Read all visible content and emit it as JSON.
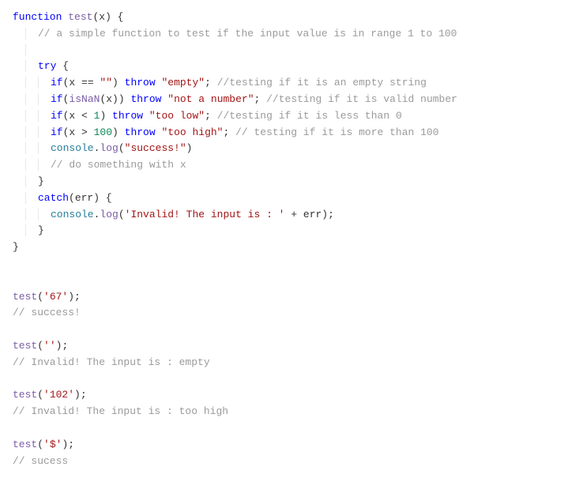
{
  "l1": {
    "kw1": "function",
    "fn": "test",
    "p1": "(",
    "arg": "x",
    "p2": ") {"
  },
  "l2": {
    "c": "// a simple function to test if the input value is in range 1 to 100"
  },
  "l3": {
    "sp": " "
  },
  "l4": {
    "kw": "try",
    "p": " {"
  },
  "l5": {
    "kw1": "if",
    "p1": "(x == ",
    "s": "\"\"",
    "p2": ") ",
    "kw2": "throw",
    "sp": " ",
    "s2": "\"empty\"",
    "p3": "; ",
    "c": "//testing if it is an empty string"
  },
  "l6": {
    "kw1": "if",
    "p1": "(",
    "fn": "isNaN",
    "p2": "(x)) ",
    "kw2": "throw",
    "sp": " ",
    "s": "\"not a number\"",
    "p3": "; ",
    "c": "//testing if it is valid number"
  },
  "l7": {
    "kw1": "if",
    "p1": "(x < ",
    "n": "1",
    "p2": ") ",
    "kw2": "throw",
    "sp": " ",
    "s": "\"too low\"",
    "p3": "; ",
    "c": "//testing if it is less than 0"
  },
  "l8": {
    "kw1": "if",
    "p1": "(x > ",
    "n": "100",
    "p2": ") ",
    "kw2": "throw",
    "sp": " ",
    "s": "\"too high\"",
    "p3": "; ",
    "c": "// testing if it is more than 100"
  },
  "l9": {
    "obj": "console",
    "p1": ".",
    "fn": "log",
    "p2": "(",
    "s": "\"success!\"",
    "p3": ")"
  },
  "l10": {
    "c": "// do something with x"
  },
  "l11": {
    "p": "}"
  },
  "l12": {
    "kw": "catch",
    "p": "(err) {"
  },
  "l13": {
    "obj": "console",
    "p1": ".",
    "fn": "log",
    "p2": "(",
    "s": "'Invalid! The input is : '",
    "p3": " + err);"
  },
  "l14": {
    "p": "}"
  },
  "l15": {
    "p": "}"
  },
  "l16": {
    "sp": " "
  },
  "l17": {
    "sp": " "
  },
  "l18": {
    "fn": "test",
    "p1": "(",
    "s": "'67'",
    "p2": ");"
  },
  "l19": {
    "c": "// success!"
  },
  "l20": {
    "sp": " "
  },
  "l21": {
    "fn": "test",
    "p1": "(",
    "s": "''",
    "p2": ");"
  },
  "l22": {
    "c": "// Invalid! The input is : empty"
  },
  "l23": {
    "sp": " "
  },
  "l24": {
    "fn": "test",
    "p1": "(",
    "s": "'102'",
    "p2": ");"
  },
  "l25": {
    "c": "// Invalid! The input is : too high"
  },
  "l26": {
    "sp": " "
  },
  "l27": {
    "fn": "test",
    "p1": "(",
    "s": "'$'",
    "p2": ");"
  },
  "l28": {
    "c": "// sucess"
  }
}
